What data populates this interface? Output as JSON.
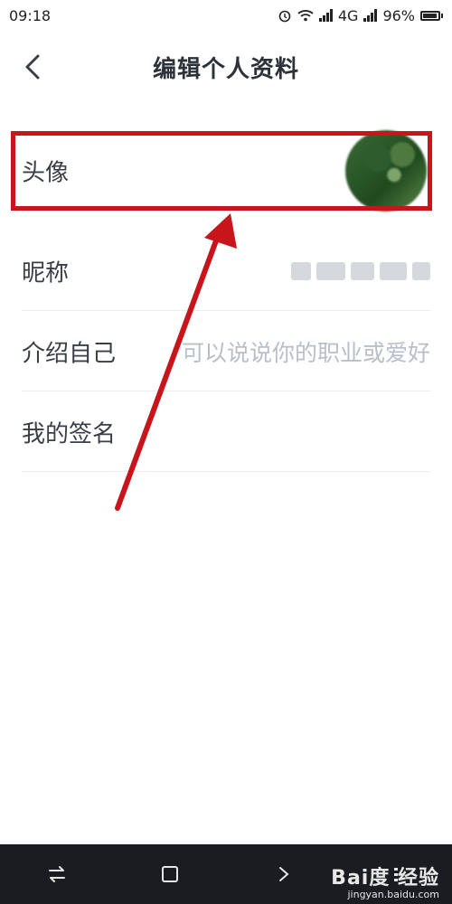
{
  "status_bar": {
    "time": "09:18",
    "network": "4G",
    "battery": "96%",
    "icons": [
      "alarm-icon",
      "wifi-icon",
      "signal-icon",
      "battery-icon"
    ]
  },
  "header": {
    "title": "编辑个人资料",
    "back_icon": "chevron-left-icon"
  },
  "profile_rows": [
    {
      "label": "头像"
    },
    {
      "label": "昵称"
    },
    {
      "label": "介绍自己",
      "placeholder": "可以说说你的职业或爱好"
    },
    {
      "label": "我的签名"
    }
  ],
  "annotation": {
    "color": "#c8151b"
  },
  "nav_bar": {
    "icons": [
      "switch-icon",
      "home-square-icon",
      "back-icon",
      "menu-icon"
    ]
  },
  "watermark": {
    "brand": "Bai度 经验",
    "url": "jingyan.baidu.com"
  }
}
